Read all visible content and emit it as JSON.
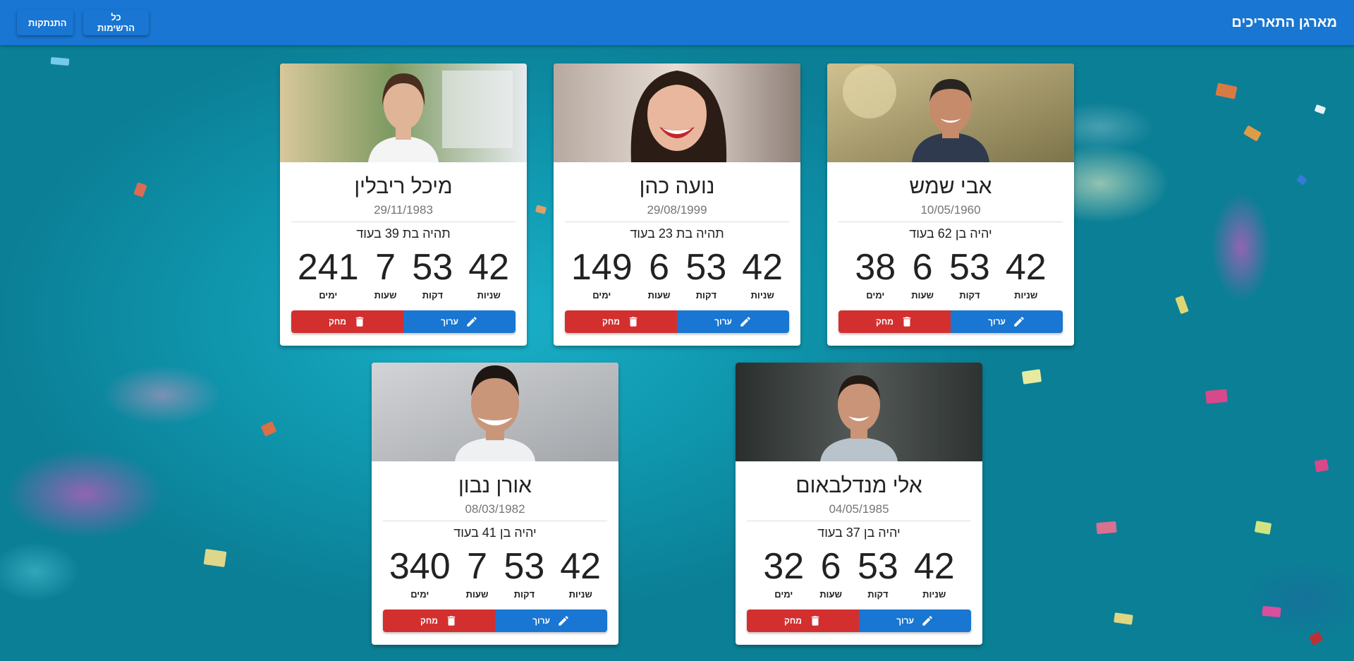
{
  "app": {
    "title": "מארגן התאריכים",
    "nav": {
      "all_lists": "כל הרשימות",
      "logout": "התנתקות"
    }
  },
  "labels": {
    "years": "שניות",
    "minutes": "דקות",
    "hours": "שעות",
    "days": "ימים",
    "edit": "ערוך",
    "delete": "מחק"
  },
  "cards": [
    {
      "name": "אבי שמש",
      "date": "10/05/1960",
      "age_text": "יהיה בן 62 בעוד",
      "countdown": {
        "seconds": "42",
        "minutes": "53",
        "hours": "6",
        "days": "38"
      },
      "photo": {
        "bg1": "#c9b98a",
        "bg2": "#8a7d4c",
        "skin": "#c58b6a",
        "hair": "#2a2420",
        "shirt": "#2f3a4e"
      }
    },
    {
      "name": "נועה כהן",
      "date": "29/08/1999",
      "age_text": "תהיה בת 23 בעוד",
      "countdown": {
        "seconds": "42",
        "minutes": "53",
        "hours": "6",
        "days": "149"
      },
      "photo": {
        "bg1": "#d9cfc8",
        "bg2": "#8e7f78",
        "skin": "#e8b79d",
        "hair": "#2b1c16",
        "shirt": "#7a5a4e"
      }
    },
    {
      "name": "מיכל ריבלין",
      "date": "29/11/1983",
      "age_text": "תהיה בת 39 בעוד",
      "countdown": {
        "seconds": "42",
        "minutes": "53",
        "hours": "7",
        "days": "241"
      },
      "photo": {
        "bg1": "#b7c7a0",
        "bg2": "#6f8a56",
        "skin": "#e0b496",
        "hair": "#4a2e20",
        "shirt": "#f4f4f4"
      }
    },
    {
      "name": "אלי מנדלבאום",
      "date": "04/05/1985",
      "age_text": "יהיה בן 37 בעוד",
      "countdown": {
        "seconds": "42",
        "minutes": "53",
        "hours": "6",
        "days": "32"
      },
      "photo": {
        "bg1": "#4a4f4e",
        "bg2": "#2e3332",
        "skin": "#c99478",
        "hair": "#231a15",
        "shirt": "#b9c3cc"
      }
    },
    {
      "name": "אורן נבון",
      "date": "08/03/1982",
      "age_text": "יהיה בן 41 בעוד",
      "countdown": {
        "seconds": "42",
        "minutes": "53",
        "hours": "7",
        "days": "340"
      },
      "photo": {
        "bg1": "#c8cacd",
        "bg2": "#a7aaae",
        "skin": "#c9967a",
        "hair": "#1e1612",
        "shirt": "#eef0f2"
      }
    }
  ]
}
